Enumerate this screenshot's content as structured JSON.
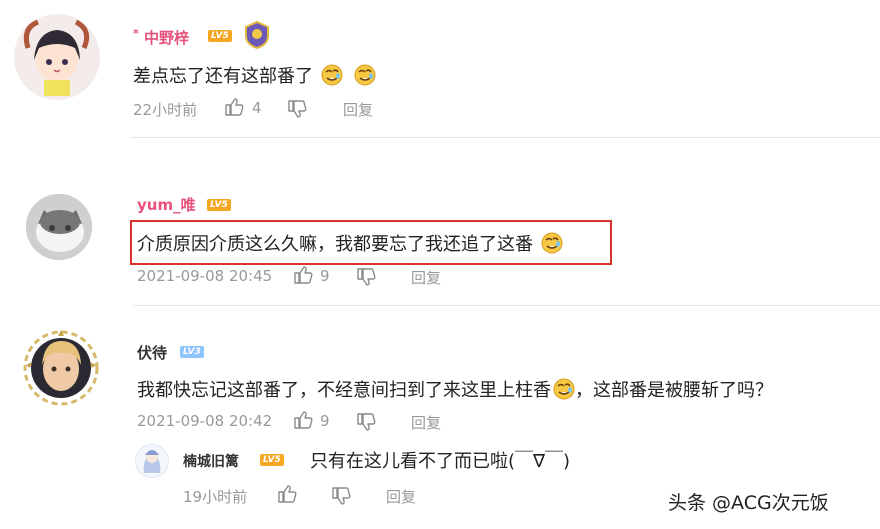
{
  "comments": [
    {
      "username": "中野梓",
      "username_prefix": "*",
      "level": "LV5",
      "content": "差点忘了还有这部番了",
      "time": "22小时前",
      "likes": "4",
      "reply_label": "回复"
    },
    {
      "username": "yum_唯",
      "level": "LV5",
      "content": "介质原因介质这么久嘛，我都要忘了我还追了这番",
      "time": "2021-09-08 20:45",
      "likes": "9",
      "reply_label": "回复"
    },
    {
      "username": "伏待",
      "level": "LV3",
      "content_before": "我都快忘记这部番了，不经意间扫到了来这里上柱香",
      "content_after": "，这部番是被腰斩了吗？",
      "time": "2021-09-08 20:42",
      "likes": "9",
      "reply_label": "回复",
      "sub_reply": {
        "username": "楠城旧篱",
        "level": "LV5",
        "content": "只有在这儿看不了而已啦(￣∇￣)",
        "time": "19小时前",
        "reply_label": "回复"
      }
    }
  ],
  "watermark": "头条 @ACG次元饭",
  "colors": {
    "username": "#e8517a",
    "highlight_border": "#d9332b",
    "meta": "#999999"
  }
}
